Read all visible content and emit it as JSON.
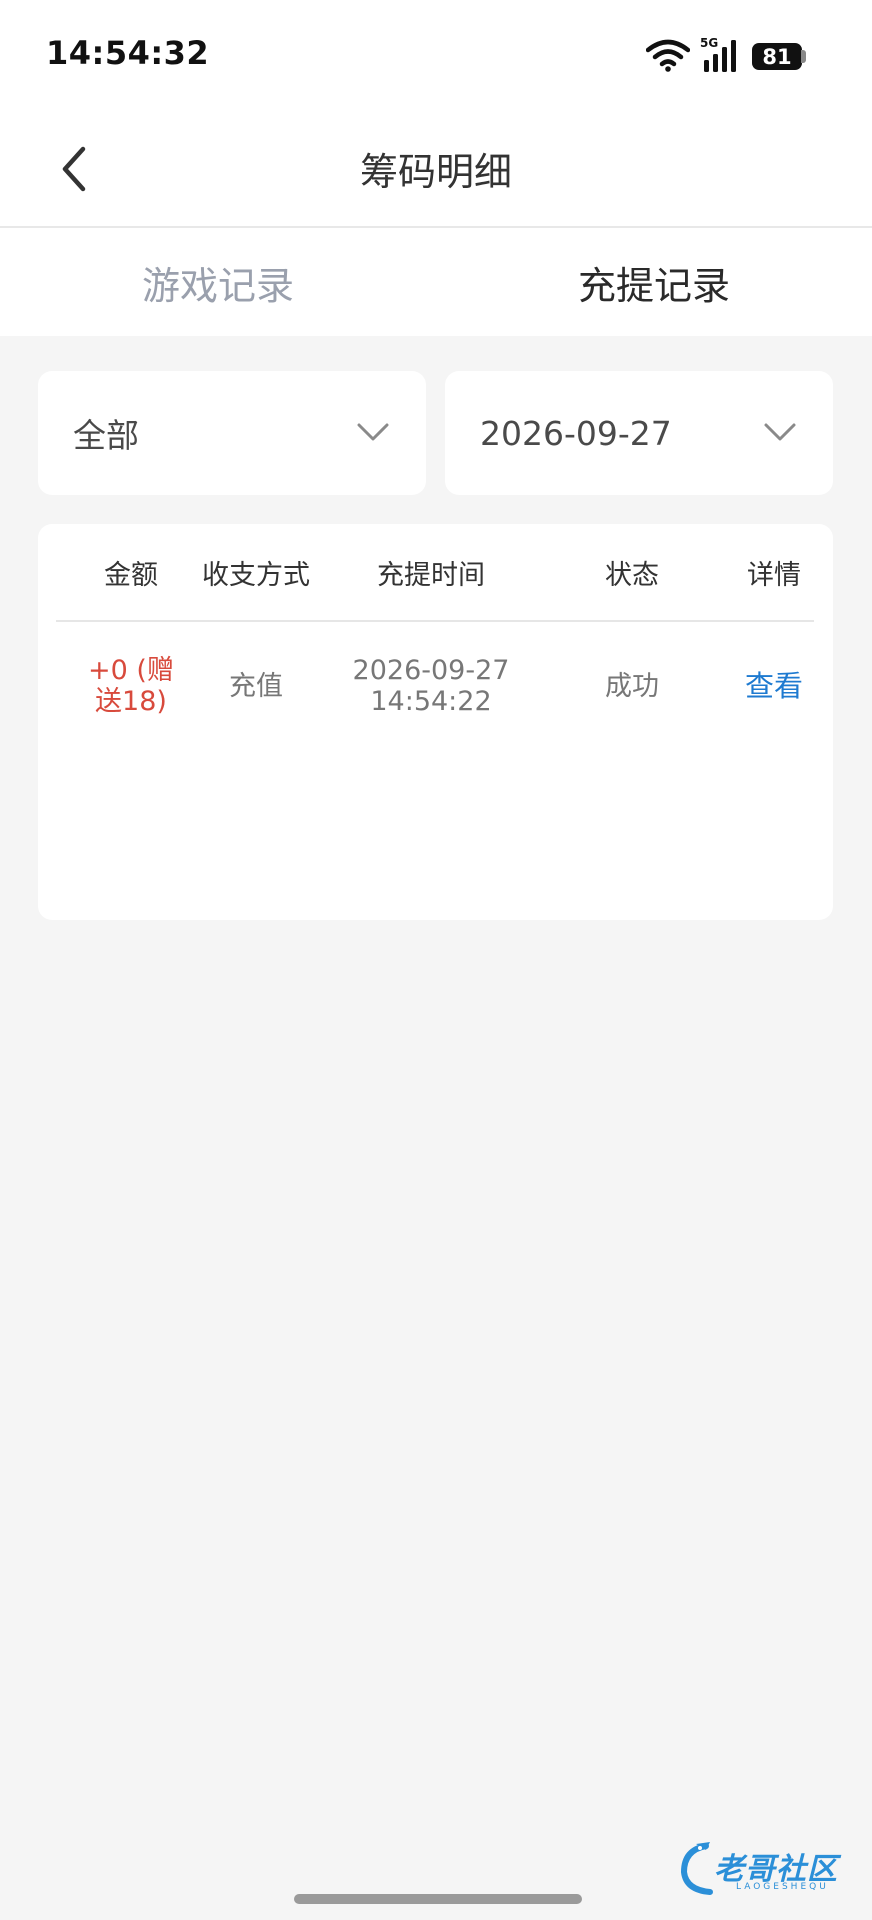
{
  "status_bar": {
    "time": "14:54:32",
    "network_label": "5G",
    "battery_level": "81",
    "icons": [
      "wifi-icon",
      "signal-icon",
      "battery-icon"
    ]
  },
  "header": {
    "title": "筹码明细",
    "back_icon": "chevron-left-icon"
  },
  "tabs": [
    {
      "label": "游戏记录",
      "active": false
    },
    {
      "label": "充提记录",
      "active": true
    }
  ],
  "filters": {
    "type": {
      "value": "全部",
      "icon": "chevron-down-icon"
    },
    "date": {
      "value": "2026-09-27",
      "icon": "chevron-down-icon"
    }
  },
  "table": {
    "headers": [
      "金额",
      "收支方式",
      "充提时间",
      "状态",
      "详情"
    ],
    "rows": [
      {
        "amount_line1": "+0 (赠",
        "amount_line2": "送18)",
        "method": "充值",
        "date": "2026-09-27",
        "time": "14:54:22",
        "status": "成功",
        "detail": "查看"
      }
    ]
  },
  "watermark": {
    "text": "老哥社区",
    "subtext": "LAOGESHEQU"
  },
  "colors": {
    "amount": "#d84a3c",
    "link": "#1e7ad0",
    "inactive_tab": "#9aa0ad",
    "background": "#f5f5f5"
  }
}
